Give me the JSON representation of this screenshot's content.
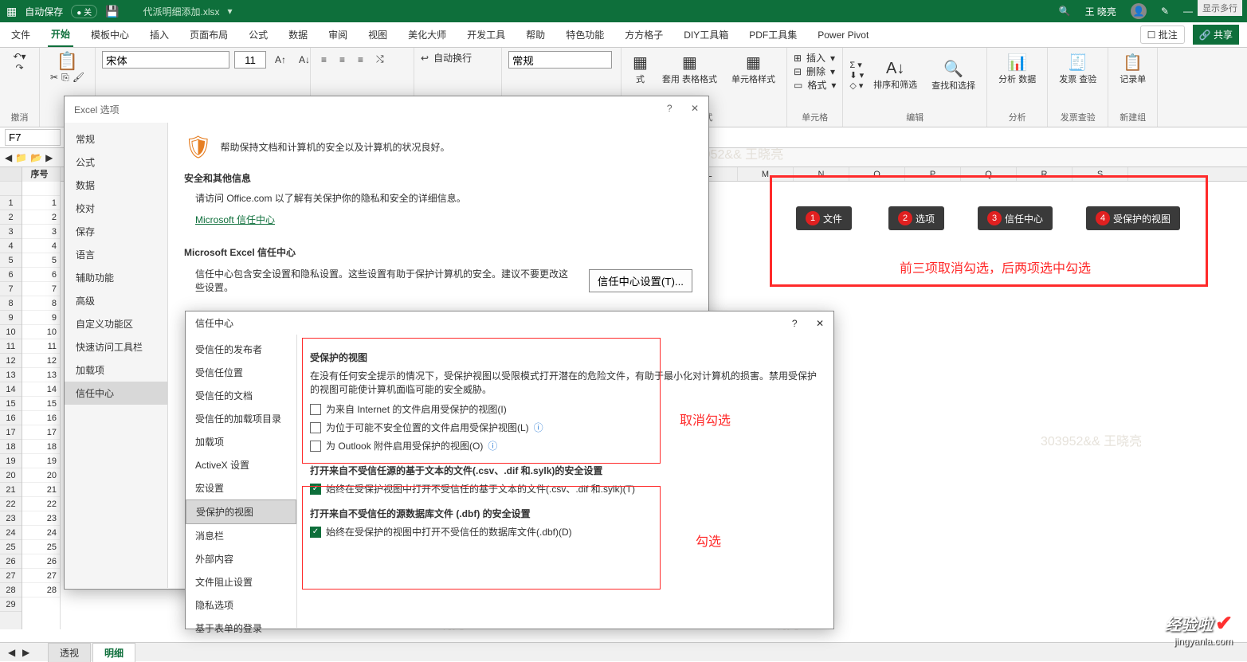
{
  "titlebar": {
    "autosave": "自动保存",
    "autosave_off": "关",
    "filename": "代派明细添加.xlsx",
    "search_icon": "search-icon",
    "username": "王 晓亮",
    "min": "—",
    "maxr": "▭",
    "close": "✕"
  },
  "tabs": {
    "file": "文件",
    "home": "开始",
    "tmpl": "模板中心",
    "insert": "插入",
    "layout": "页面布局",
    "formula": "公式",
    "data": "数据",
    "review": "审阅",
    "view": "视图",
    "beautify": "美化大师",
    "dev": "开发工具",
    "help": "帮助",
    "feat": "特色功能",
    "square": "方方格子",
    "diy": "DIY工具箱",
    "pdf": "PDF工具集",
    "pivot": "Power Pivot",
    "comment": "批注",
    "share": "共享"
  },
  "ribbon": {
    "font_name": "宋体",
    "font_size": "11",
    "wrap": "自动换行",
    "numfmt": "常规",
    "undo": "撤消",
    "cond": "条件格式",
    "tblfmt": "套用\n表格格式",
    "cellstyle": "单元格样式",
    "insert": "插入",
    "delete": "删除",
    "format": "格式",
    "sortfilter": "排序和筛选",
    "findsel": "查找和选择",
    "analyze": "分析\n数据",
    "invoice": "发票\n查验",
    "record": "记录单",
    "g_style": "样式",
    "g_cell": "单元格",
    "g_edit": "编辑",
    "g_analyze": "分析",
    "g_inv": "发票查验",
    "g_new": "新建组"
  },
  "namebox": "F7",
  "colB_header": "序号",
  "row_nums": [
    "1",
    "2",
    "3",
    "4",
    "5",
    "6",
    "7",
    "8",
    "9",
    "10",
    "11",
    "12",
    "13",
    "14",
    "15",
    "16",
    "17",
    "18",
    "19",
    "20",
    "21",
    "22",
    "23",
    "24",
    "25",
    "26",
    "27",
    "28",
    "29"
  ],
  "colB_vals": [
    "1",
    "2",
    "3",
    "4",
    "5",
    "6",
    "7",
    "8",
    "9",
    "10",
    "11",
    "12",
    "13",
    "14",
    "15",
    "16",
    "17",
    "18",
    "19",
    "20",
    "21",
    "22",
    "23",
    "24",
    "25",
    "26",
    "27",
    "28"
  ],
  "colhdrs": [
    "L",
    "M",
    "N",
    "O",
    "P",
    "Q",
    "R",
    "S"
  ],
  "show_more": "显示多行",
  "options_dialog": {
    "title": "Excel 选项",
    "help": "?",
    "close": "✕",
    "nav": [
      "常规",
      "公式",
      "数据",
      "校对",
      "保存",
      "语言",
      "辅助功能",
      "高级",
      "自定义功能区",
      "快速访问工具栏",
      "加载项",
      "信任中心"
    ],
    "nav_selected": "信任中心",
    "shield_line": "帮助保持文档和计算机的安全以及计算机的状况良好。",
    "sec1": "安全和其他信息",
    "sec1_line": "请访问 Office.com 以了解有关保护你的隐私和安全的详细信息。",
    "mstc_link": "Microsoft 信任中心",
    "sec2": "Microsoft Excel 信任中心",
    "sec2_line": "信任中心包含安全设置和隐私设置。这些设置有助于保护计算机的安全。建议不要更改这些设置。",
    "tc_btn": "信任中心设置(T)..."
  },
  "trust_dialog": {
    "title": "信任中心",
    "help": "?",
    "close": "✕",
    "nav": [
      "受信任的发布者",
      "受信任位置",
      "受信任的文档",
      "受信任的加载项目录",
      "加载项",
      "ActiveX 设置",
      "宏设置",
      "受保护的视图",
      "消息栏",
      "外部内容",
      "文件阻止设置",
      "隐私选项",
      "基于表单的登录"
    ],
    "nav_selected": "受保护的视图",
    "h1": "受保护的视图",
    "p1": "在没有任何安全提示的情况下，受保护视图以受限模式打开潜在的危险文件，有助于最小化对计算机的损害。禁用受保护的视图可能使计算机面临可能的安全威胁。",
    "chk1": "为来自 Internet 的文件启用受保护的视图(I)",
    "chk2": "为位于可能不安全位置的文件启用受保护视图(L)",
    "chk3": "为 Outlook 附件启用受保护的视图(O)",
    "h2": "打开来自不受信任源的基于文本的文件(.csv、.dif 和.sylk)的安全设置",
    "chk4": "始终在受保护视图中打开不受信任的基于文本的文件(.csv、.dif 和.sylk)(T)",
    "h3": "打开来自不受信任的源数据库文件 (.dbf) 的安全设置",
    "chk5": "始终在受保护的视图中打开不受信任的数据库文件(.dbf)(D)"
  },
  "callouts": {
    "c1": "文件",
    "c2": "选项",
    "c3": "信任中心",
    "c4": "受保护的视图",
    "line": "前三项取消勾选，后两项选中勾选",
    "uncheck": "取消勾选",
    "check": "勾选"
  },
  "sheet_tabs": {
    "t1": "透视",
    "t2": "明细"
  },
  "watermark": "303952&& 王晓亮",
  "logo": {
    "big": "经验啦",
    "small": "jingyanla.com"
  }
}
